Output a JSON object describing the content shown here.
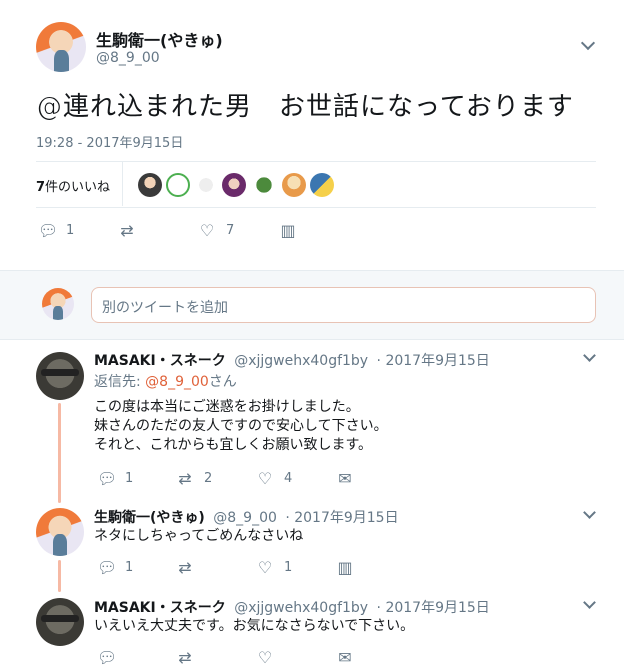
{
  "tweet": {
    "display_name": "生駒衛一(やきゅ)",
    "handle": "@8_9_00",
    "text": "@連れ込まれた男　お世話になっております",
    "timestamp": "19:28 - 2017年9月15日",
    "likes_count": "7",
    "likes_suffix": "件のいいね",
    "reply_count": "1",
    "like_count": "7"
  },
  "reply_box": {
    "placeholder": "別のツイートを追加"
  },
  "replies": [
    {
      "display_name": "MASAKI・スネーク",
      "handle": "@xjjgwehx40gf1by",
      "date": "· 2017年9月15日",
      "replying_prefix": "返信先: ",
      "replying_handle": "@8_9_00",
      "replying_suffix": "さん",
      "lines": [
        "この度は本当にご迷惑をお掛けしました。",
        "妹さんのただの友人ですので安心して下さい。",
        "それと、これからも宜しくお願い致します。"
      ],
      "reply_count": "1",
      "retweet_count": "2",
      "like_count": "4"
    },
    {
      "display_name": "生駒衛一(やきゅ)",
      "handle": "@8_9_00",
      "date": "· 2017年9月15日",
      "lines": [
        "ネタにしちゃってごめんなさいね"
      ],
      "reply_count": "1",
      "like_count": "1"
    },
    {
      "display_name": "MASAKI・スネーク",
      "handle": "@xjjgwehx40gf1by",
      "date": "· 2017年9月15日",
      "lines": [
        "いえいえ大丈夫です。お気になさらないで下さい。"
      ]
    }
  ],
  "colors": {
    "accent": "#e0623a",
    "thread_line": "#f6b9a4",
    "secondary_text": "#657786",
    "divider": "#e6ecf0"
  },
  "icons": [
    "reply-icon",
    "retweet-icon",
    "heart-icon",
    "analytics-icon",
    "mail-icon",
    "chevron-down-icon"
  ]
}
